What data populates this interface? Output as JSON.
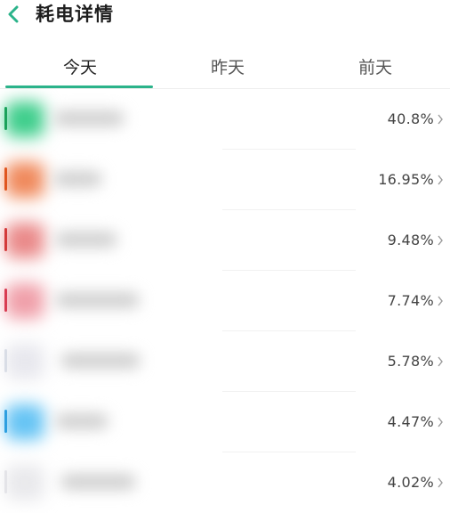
{
  "header": {
    "title": "耗电详情",
    "back_icon": "chevron-left-icon",
    "accent_color": "#2bb38a"
  },
  "tabs": [
    {
      "label": "今天",
      "active": true
    },
    {
      "label": "昨天",
      "active": false
    },
    {
      "label": "前天",
      "active": false
    }
  ],
  "apps": [
    {
      "percent": "40.8%",
      "icon_color": "#3fce8c",
      "edge_color": "#1aa25a"
    },
    {
      "percent": "16.95%",
      "icon_color": "#f08a5d",
      "edge_color": "#e0561f"
    },
    {
      "percent": "9.48%",
      "icon_color": "#ea8a8a",
      "edge_color": "#d33a3a"
    },
    {
      "percent": "7.74%",
      "icon_color": "#f0a0aa",
      "edge_color": "#d83c52"
    },
    {
      "percent": "5.78%",
      "icon_color": "#e8e8ee",
      "edge_color": "#d9dde6"
    },
    {
      "percent": "4.47%",
      "icon_color": "#66c4f4",
      "edge_color": "#2d9fe0"
    },
    {
      "percent": "4.02%",
      "icon_color": "#e9e9ec",
      "edge_color": "#e4e4e8"
    }
  ],
  "row_chevron_icon": "chevron-right-icon"
}
